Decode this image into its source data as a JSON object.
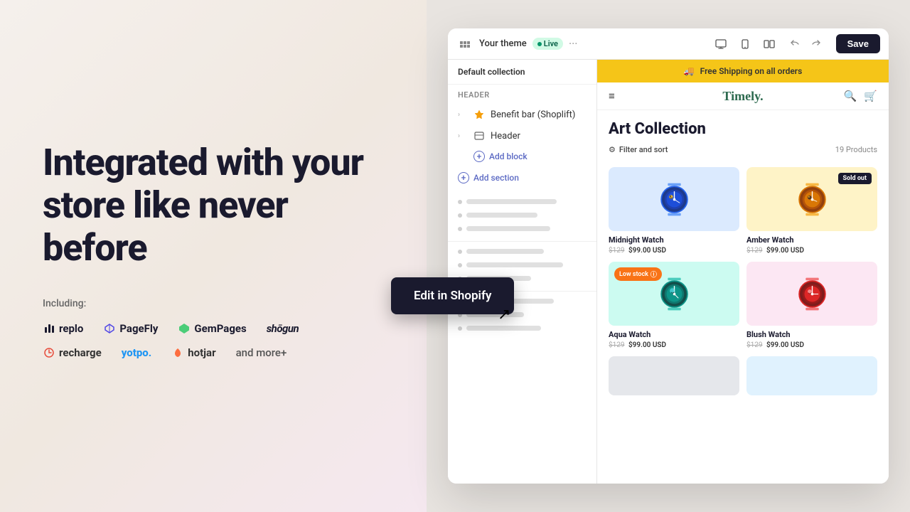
{
  "hero": {
    "title": "Integrated with your store like never before",
    "including_label": "Including:",
    "logos_row1": [
      {
        "id": "replo",
        "label": "replo",
        "icon": "⚡"
      },
      {
        "id": "pagefly",
        "label": "PageFly",
        "icon": "✦"
      },
      {
        "id": "gempages",
        "label": "GemPages",
        "icon": "◆"
      },
      {
        "id": "shogun",
        "label": "shōgun",
        "icon": ""
      }
    ],
    "logos_row2": [
      {
        "id": "recharge",
        "label": "recharge",
        "icon": "⟳"
      },
      {
        "id": "yotpo",
        "label": "yotpo.",
        "icon": ""
      },
      {
        "id": "hotjar",
        "label": "hotjar",
        "icon": "🔥"
      },
      {
        "id": "andmore",
        "label": "and more+",
        "icon": ""
      }
    ]
  },
  "edit_button": {
    "label": "Edit in Shopify"
  },
  "toolbar": {
    "theme_name": "Your theme",
    "live_label": "Live",
    "save_label": "Save",
    "dots": "···"
  },
  "panel": {
    "breadcrumb": "Default collection",
    "section_label": "Header",
    "items": [
      {
        "label": "Benefit bar (Shoplift)",
        "icon": "⚡"
      },
      {
        "label": "Header",
        "icon": "▦"
      }
    ],
    "add_block": "Add block",
    "add_section": "Add section"
  },
  "store": {
    "shipping_banner": "Free Shipping on all orders",
    "logo": "Timely.",
    "collection_title": "Art Collection",
    "filter_label": "Filter and sort",
    "product_count": "19 Products",
    "products": [
      {
        "id": "midnight",
        "name": "Midnight Watch",
        "original_price": "$129",
        "sale_price": "$99.00 USD",
        "bg": "blue-bg",
        "badge": null,
        "color": "#3b82f6"
      },
      {
        "id": "amber",
        "name": "Amber Watch",
        "original_price": "$129",
        "sale_price": "$99.00 USD",
        "bg": "yellow-bg",
        "badge": "sold-out",
        "color": "#f59e0b"
      },
      {
        "id": "aqua",
        "name": "Aqua Watch",
        "original_price": "$129",
        "sale_price": "$99.00 USD",
        "bg": "teal-bg",
        "badge": "low-stock",
        "color": "#14b8a6"
      },
      {
        "id": "blush",
        "name": "Blush Watch",
        "original_price": "$129",
        "sale_price": "$99.00 USD",
        "bg": "pink-bg",
        "badge": null,
        "color": "#ef4444"
      }
    ]
  }
}
